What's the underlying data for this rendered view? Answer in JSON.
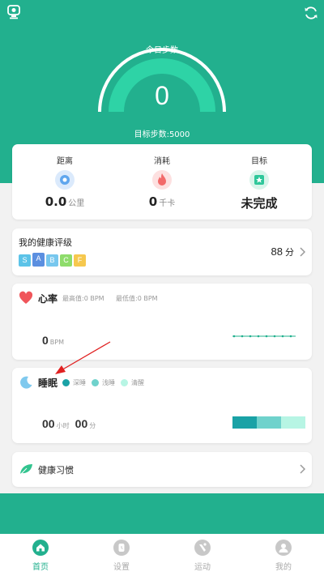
{
  "header": {
    "today_steps_label": "今日步数",
    "steps_value": "0",
    "goal_label": "目标步数:5000"
  },
  "summary": [
    {
      "label": "距离",
      "value": "0.0",
      "unit": "公里",
      "icon": "distance-icon"
    },
    {
      "label": "消耗",
      "value": "0",
      "unit": "千卡",
      "icon": "flame-icon"
    },
    {
      "label": "目标",
      "value": "未完成",
      "unit": "",
      "icon": "target-star-icon"
    }
  ],
  "rating": {
    "title": "我的健康评级",
    "grades": [
      "S",
      "A",
      "B",
      "C",
      "F"
    ],
    "grade_colors": [
      "#5cc3e8",
      "#5b8fe0",
      "#77c7ee",
      "#8edc6b",
      "#f6c84e"
    ],
    "selected_grade": "A",
    "score": "88",
    "score_unit": "分"
  },
  "heart": {
    "title": "心率",
    "max_label": "最高值:0 BPM",
    "min_label": "最低值:0 BPM",
    "value": "0",
    "unit": "BPM"
  },
  "sleep": {
    "title": "睡眠",
    "legend": [
      {
        "label": "深睡",
        "color": "#1aa2a6"
      },
      {
        "label": "浅睡",
        "color": "#6fd2cc"
      },
      {
        "label": "清醒",
        "color": "#b7f5e4"
      }
    ],
    "hours": "00",
    "hours_unit": "小时",
    "minutes": "00",
    "minutes_unit": "分"
  },
  "habit": {
    "title": "健康习惯"
  },
  "tabs": [
    {
      "label": "首页",
      "icon": "home-icon",
      "active": true
    },
    {
      "label": "设置",
      "icon": "watch-icon",
      "active": false
    },
    {
      "label": "运动",
      "icon": "sport-icon",
      "active": false
    },
    {
      "label": "我的",
      "icon": "profile-icon",
      "active": false
    }
  ],
  "colors": {
    "brand": "#22b08e",
    "gauge_fill": "#2ed3a6",
    "annotation_arrow": "#e02020"
  }
}
